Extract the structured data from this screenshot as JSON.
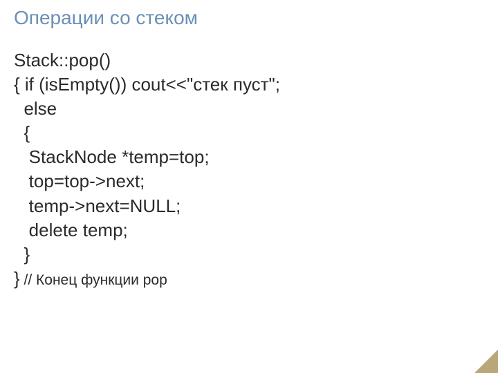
{
  "title": "Операции со стеком",
  "code": {
    "l1": "Stack::pop()",
    "l2": "{ if (isEmpty()) cout<<\"стек пуст\";",
    "l3": "  else",
    "l4": "  {",
    "l5": "   StackNode *temp=top;",
    "l6": "   top=top->next;",
    "l7": "   temp->next=NULL;",
    "l8": "   delete temp;",
    "l9": "  }",
    "l10_close": "}",
    "l10_comment": " // Конец функции pop"
  }
}
